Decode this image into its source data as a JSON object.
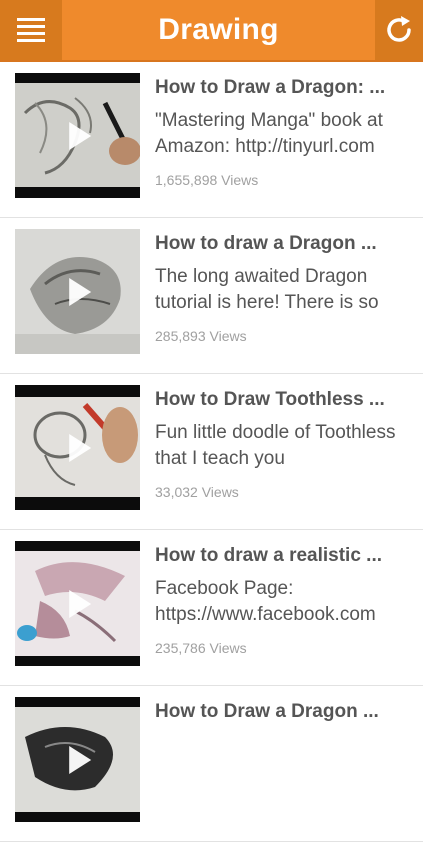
{
  "header": {
    "title": "Drawing",
    "menu_icon": "hamburger-menu-icon",
    "refresh_icon": "refresh-icon",
    "bar_color": "#ef8a2c",
    "button_color": "#d77a1e"
  },
  "videos": [
    {
      "title": "How to Draw a Dragon: ...",
      "description": "\"Mastering Manga\" book at Amazon: http://tinyurl.com",
      "views": "1,655,898 Views"
    },
    {
      "title": "How to draw a Dragon ...",
      "description": "The long awaited Dragon tutorial is here! There is so",
      "views": "285,893 Views"
    },
    {
      "title": "How to Draw Toothless ...",
      "description": "Fun little doodle of Toothless that I teach you",
      "views": "33,032 Views"
    },
    {
      "title": "How to draw a realistic ...",
      "description": "Facebook Page: https://www.facebook.com",
      "views": "235,786 Views"
    },
    {
      "title": "How to Draw a Dragon ...",
      "description": "",
      "views": ""
    }
  ]
}
